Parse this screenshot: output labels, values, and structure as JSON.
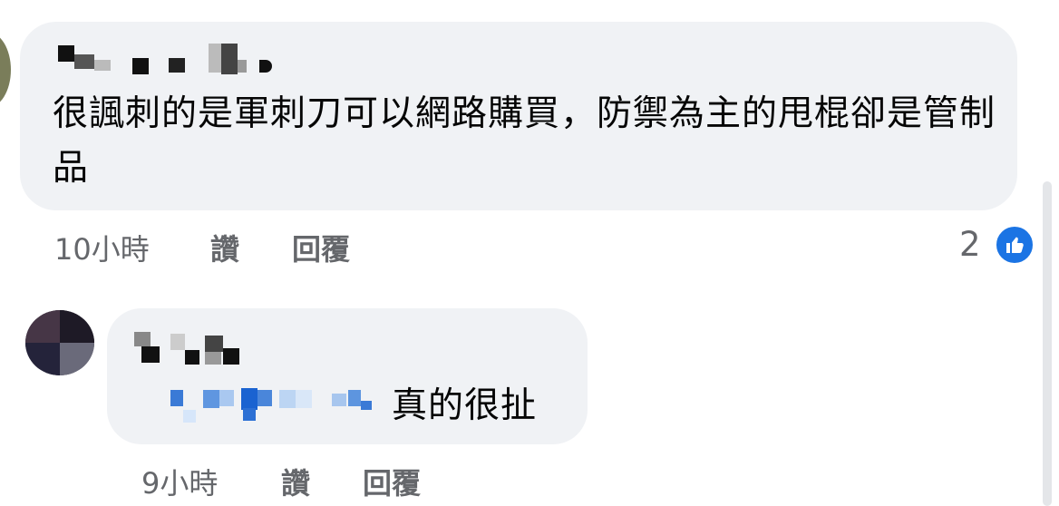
{
  "comments": [
    {
      "text": "很諷刺的是軍刺刀可以網路購買，防禦為主的甩棍卻是管制品",
      "time": "10小時",
      "like_label": "讚",
      "reply_label": "回覆",
      "reaction_count": "2",
      "reaction_icon": "thumbs-up-icon"
    },
    {
      "text": "真的很扯",
      "time": "9小時",
      "like_label": "讚",
      "reply_label": "回覆"
    }
  ],
  "colors": {
    "bubble": "#f0f2f5",
    "meta_text": "#65676b",
    "like_blue": "#1b74e4"
  }
}
